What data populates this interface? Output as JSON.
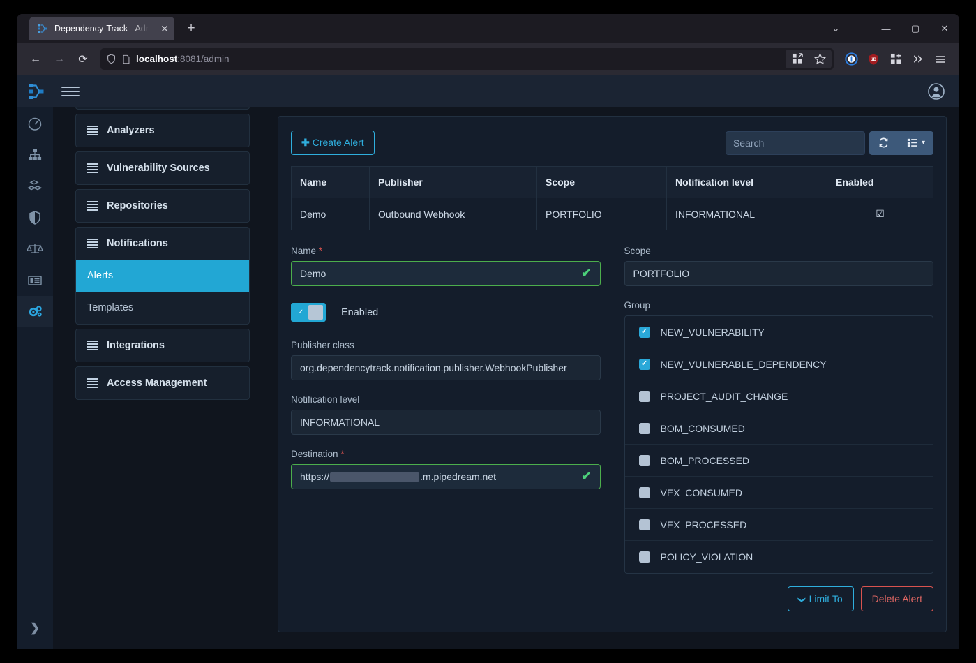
{
  "browser": {
    "tab": {
      "title": "Dependency-Track - Admi",
      "favicon": "dependency-track-favicon",
      "close_label": "✕"
    },
    "newtab_label": "+",
    "window_controls": {
      "tab_list": "⌄",
      "minimize": "—",
      "maximize": "▢",
      "close": "✕"
    },
    "nav": {
      "back": "←",
      "forward": "→",
      "reload": "⟳"
    },
    "url": {
      "host": "localhost",
      "rest": ":8081/admin",
      "shield_icon": "shield-icon",
      "page_icon": "page-icon"
    },
    "toolbar_icons": [
      "split-view-icon",
      "bookmark-star-icon",
      "onepassword-icon",
      "ublock-origin-icon",
      "extensions-icon",
      "overflow-chevrons-icon",
      "app-menu-icon"
    ]
  },
  "app": {
    "logo": "dependency-track-logo",
    "menu_toggle": "hamburger-menu-icon",
    "account": "user-avatar-icon",
    "rail": [
      {
        "name": "dashboard",
        "icon": "gauge-icon",
        "active": false
      },
      {
        "name": "projects",
        "icon": "hierarchy-icon",
        "active": false
      },
      {
        "name": "components",
        "icon": "cubes-icon",
        "active": false
      },
      {
        "name": "vulnerabilities",
        "icon": "shield-icon",
        "active": false
      },
      {
        "name": "licenses",
        "icon": "scales-icon",
        "active": false
      },
      {
        "name": "policy",
        "icon": "list-icon",
        "active": false
      },
      {
        "name": "administration",
        "icon": "gears-icon",
        "active": true
      }
    ],
    "rail_expand": "❯"
  },
  "sidebar": {
    "groups": [
      {
        "label": "Analyzers"
      },
      {
        "label": "Vulnerability Sources"
      },
      {
        "label": "Repositories"
      },
      {
        "label": "Notifications",
        "children": [
          {
            "label": "Alerts",
            "active": true
          },
          {
            "label": "Templates",
            "active": false
          }
        ]
      },
      {
        "label": "Integrations"
      },
      {
        "label": "Access Management"
      }
    ]
  },
  "toolbar": {
    "create_label": "Create Alert",
    "create_plus": "✚",
    "search_placeholder": "Search",
    "search_value": "",
    "refresh_icon": "refresh-icon",
    "columns_icon": "columns-icon",
    "caret": "▾"
  },
  "table": {
    "columns": [
      "Name",
      "Publisher",
      "Scope",
      "Notification level",
      "Enabled"
    ],
    "rows": [
      {
        "name": "Demo",
        "publisher": "Outbound Webhook",
        "scope": "PORTFOLIO",
        "level": "INFORMATIONAL",
        "enabled": "☑"
      }
    ]
  },
  "form": {
    "name_label": "Name",
    "name_value": "Demo",
    "required_mark": "*",
    "valid_tick": "✔",
    "enabled_label": "Enabled",
    "enabled_toggle_check": "✓",
    "publisher_class_label": "Publisher class",
    "publisher_class_value": "org.dependencytrack.notification.publisher.WebhookPublisher",
    "notification_level_label": "Notification level",
    "notification_level_value": "INFORMATIONAL",
    "destination_label": "Destination",
    "destination_prefix": "https://",
    "destination_suffix": ".m.pipedream.net",
    "scope_label": "Scope",
    "scope_value": "PORTFOLIO",
    "group_label": "Group",
    "groups": [
      {
        "label": "NEW_VULNERABILITY",
        "checked": true
      },
      {
        "label": "NEW_VULNERABLE_DEPENDENCY",
        "checked": true
      },
      {
        "label": "PROJECT_AUDIT_CHANGE",
        "checked": false
      },
      {
        "label": "BOM_CONSUMED",
        "checked": false
      },
      {
        "label": "BOM_PROCESSED",
        "checked": false
      },
      {
        "label": "VEX_CONSUMED",
        "checked": false
      },
      {
        "label": "VEX_PROCESSED",
        "checked": false
      },
      {
        "label": "POLICY_VIOLATION",
        "checked": false
      }
    ],
    "limit_to_label": "Limit To",
    "limit_to_caret": "❯",
    "delete_label": "Delete Alert"
  },
  "colors": {
    "accent": "#22a7d4",
    "link": "#2faedd",
    "danger": "#d9534f",
    "valid": "#4cae4c",
    "page_bg": "#10151e",
    "panel_bg": "#141d2b"
  }
}
